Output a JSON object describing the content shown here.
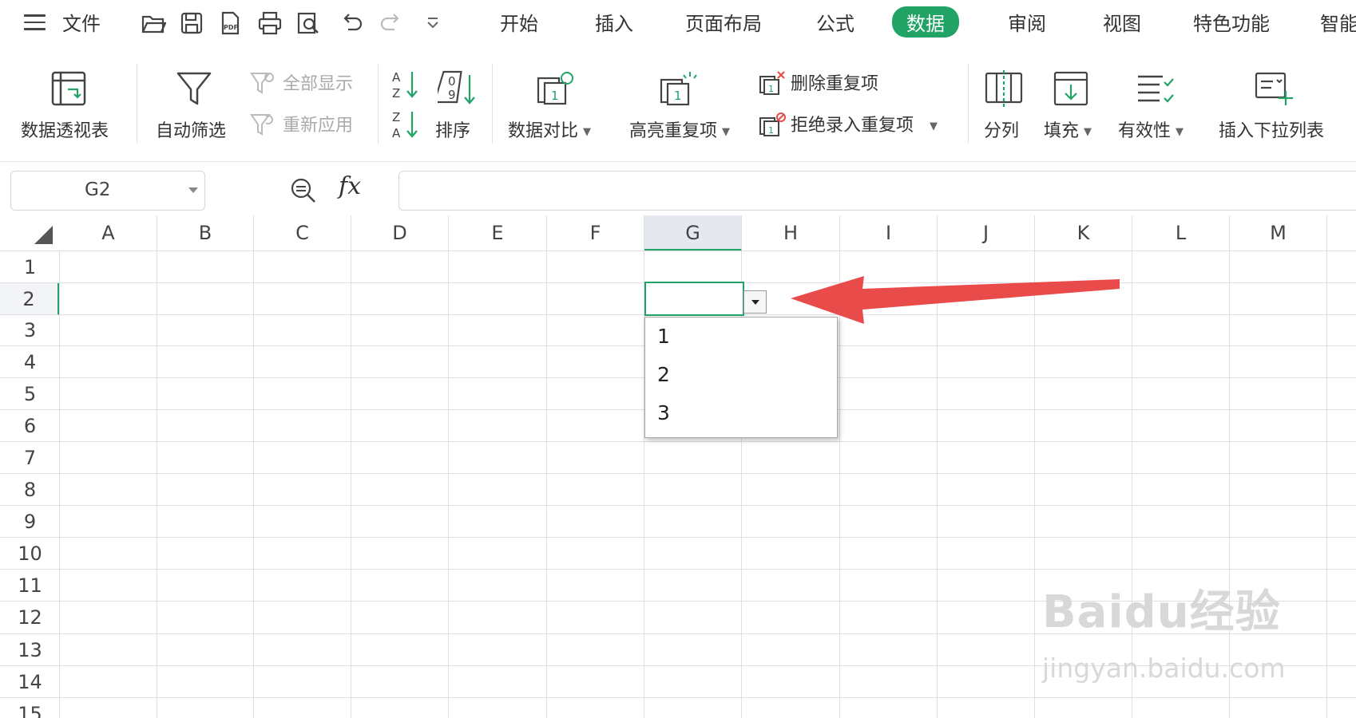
{
  "menubar": {
    "file_label": "文件",
    "tabs": [
      "开始",
      "插入",
      "页面布局",
      "公式",
      "数据",
      "审阅",
      "视图",
      "特色功能",
      "智能"
    ],
    "active_tab": "数据"
  },
  "ribbon": {
    "pivot": "数据透视表",
    "autofilter": "自动筛选",
    "show_all": "全部显示",
    "reapply": "重新应用",
    "sort": "排序",
    "compare": "数据对比",
    "highlight_dup": "高亮重复项",
    "remove_dup": "删除重复项",
    "reject_dup": "拒绝录入重复项",
    "split": "分列",
    "fill": "填充",
    "validity": "有效性",
    "insert_dropdown": "插入下拉列表"
  },
  "formula_bar": {
    "cell_ref": "G2",
    "fx": "fx",
    "formula": ""
  },
  "grid": {
    "columns": [
      "A",
      "B",
      "C",
      "D",
      "E",
      "F",
      "G",
      "H",
      "I",
      "J",
      "K",
      "L",
      "M"
    ],
    "rows": [
      "1",
      "2",
      "3",
      "4",
      "5",
      "6",
      "7",
      "8",
      "9",
      "10",
      "11",
      "12",
      "13",
      "14",
      "15"
    ],
    "selected_column": "G",
    "selected_row": "2"
  },
  "dropdown": {
    "options": [
      "1",
      "2",
      "3"
    ]
  },
  "watermark": {
    "brand": "Baidu经验",
    "url": "jingyan.baidu.com"
  },
  "colors": {
    "accent": "#21a366",
    "arrow": "#e94a4a"
  }
}
